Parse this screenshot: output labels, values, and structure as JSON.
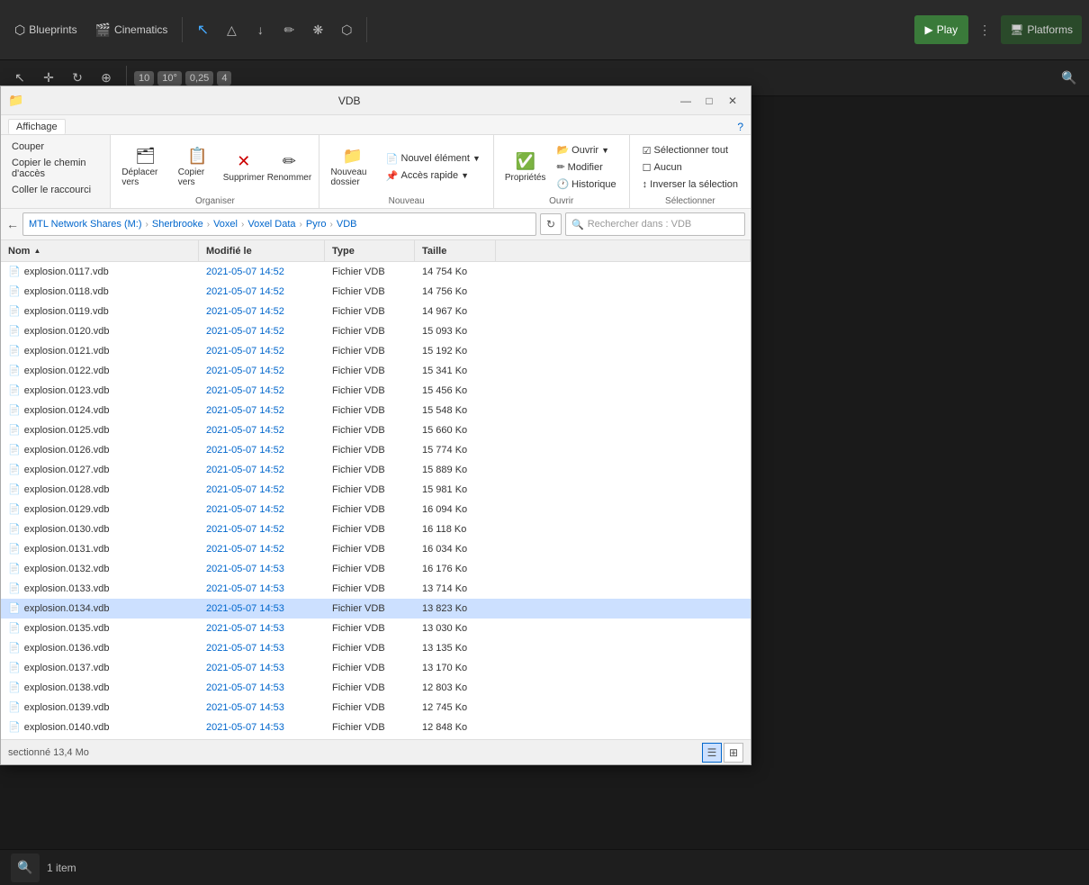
{
  "topbar": {
    "blueprints_label": "Blueprints",
    "cinematics_label": "Cinematics",
    "play_label": "Play",
    "platforms_label": "Platforms",
    "toolbar_nums": {
      "grid": "10",
      "angle": "10°",
      "scale": "0,25",
      "layers": "4"
    }
  },
  "window": {
    "title": "VDB",
    "ribbon": {
      "affichage_label": "Affichage",
      "context_menu": [
        "Couper",
        "Copier le chemin d'accès",
        "Coller le raccourci"
      ],
      "groups": {
        "organiser": {
          "label": "Organiser",
          "btn_deplacer": "Déplacer vers",
          "btn_copier": "Copier vers",
          "btn_supprimer": "Supprimer",
          "btn_renommer": "Renommer"
        },
        "nouveau": {
          "label": "Nouveau",
          "btn_nouveau_dossier": "Nouveau dossier",
          "btn_nouvel_element": "Nouvel élément",
          "btn_acces_rapide": "Accès rapide"
        },
        "ouvrir": {
          "label": "Ouvrir",
          "btn_proprietes": "Propriétés",
          "btn_ouvrir": "Ouvrir",
          "btn_modifier": "Modifier",
          "btn_historique": "Historique"
        },
        "selectionner": {
          "label": "Sélectionner",
          "btn_tout": "Sélectionner tout",
          "btn_aucun": "Aucun",
          "btn_inverser": "Inverser la sélection"
        }
      }
    },
    "breadcrumb": {
      "parts": [
        "MTL Network Shares (M:)",
        "Sherbrooke",
        "Voxel",
        "Voxel Data",
        "Pyro",
        "VDB"
      ]
    },
    "search_placeholder": "Rechercher dans : VDB",
    "columns": {
      "name": "Nom",
      "modified": "Modifié le",
      "type": "Type",
      "size": "Taille"
    },
    "files": [
      {
        "name": "explosion.0117.vdb",
        "modified": "2021-05-07 14:52",
        "type": "Fichier VDB",
        "size": "14 754 Ko"
      },
      {
        "name": "explosion.0118.vdb",
        "modified": "2021-05-07 14:52",
        "type": "Fichier VDB",
        "size": "14 756 Ko"
      },
      {
        "name": "explosion.0119.vdb",
        "modified": "2021-05-07 14:52",
        "type": "Fichier VDB",
        "size": "14 967 Ko"
      },
      {
        "name": "explosion.0120.vdb",
        "modified": "2021-05-07 14:52",
        "type": "Fichier VDB",
        "size": "15 093 Ko"
      },
      {
        "name": "explosion.0121.vdb",
        "modified": "2021-05-07 14:52",
        "type": "Fichier VDB",
        "size": "15 192 Ko"
      },
      {
        "name": "explosion.0122.vdb",
        "modified": "2021-05-07 14:52",
        "type": "Fichier VDB",
        "size": "15 341 Ko"
      },
      {
        "name": "explosion.0123.vdb",
        "modified": "2021-05-07 14:52",
        "type": "Fichier VDB",
        "size": "15 456 Ko"
      },
      {
        "name": "explosion.0124.vdb",
        "modified": "2021-05-07 14:52",
        "type": "Fichier VDB",
        "size": "15 548 Ko"
      },
      {
        "name": "explosion.0125.vdb",
        "modified": "2021-05-07 14:52",
        "type": "Fichier VDB",
        "size": "15 660 Ko"
      },
      {
        "name": "explosion.0126.vdb",
        "modified": "2021-05-07 14:52",
        "type": "Fichier VDB",
        "size": "15 774 Ko"
      },
      {
        "name": "explosion.0127.vdb",
        "modified": "2021-05-07 14:52",
        "type": "Fichier VDB",
        "size": "15 889 Ko"
      },
      {
        "name": "explosion.0128.vdb",
        "modified": "2021-05-07 14:52",
        "type": "Fichier VDB",
        "size": "15 981 Ko"
      },
      {
        "name": "explosion.0129.vdb",
        "modified": "2021-05-07 14:52",
        "type": "Fichier VDB",
        "size": "16 094 Ko"
      },
      {
        "name": "explosion.0130.vdb",
        "modified": "2021-05-07 14:52",
        "type": "Fichier VDB",
        "size": "16 118 Ko"
      },
      {
        "name": "explosion.0131.vdb",
        "modified": "2021-05-07 14:52",
        "type": "Fichier VDB",
        "size": "16 034 Ko"
      },
      {
        "name": "explosion.0132.vdb",
        "modified": "2021-05-07 14:53",
        "type": "Fichier VDB",
        "size": "16 176 Ko"
      },
      {
        "name": "explosion.0133.vdb",
        "modified": "2021-05-07 14:53",
        "type": "Fichier VDB",
        "size": "13 714 Ko"
      },
      {
        "name": "explosion.0134.vdb",
        "modified": "2021-05-07 14:53",
        "type": "Fichier VDB",
        "size": "13 823 Ko",
        "selected": true
      },
      {
        "name": "explosion.0135.vdb",
        "modified": "2021-05-07 14:53",
        "type": "Fichier VDB",
        "size": "13 030 Ko"
      },
      {
        "name": "explosion.0136.vdb",
        "modified": "2021-05-07 14:53",
        "type": "Fichier VDB",
        "size": "13 135 Ko"
      },
      {
        "name": "explosion.0137.vdb",
        "modified": "2021-05-07 14:53",
        "type": "Fichier VDB",
        "size": "13 170 Ko"
      },
      {
        "name": "explosion.0138.vdb",
        "modified": "2021-05-07 14:53",
        "type": "Fichier VDB",
        "size": "12 803 Ko"
      },
      {
        "name": "explosion.0139.vdb",
        "modified": "2021-05-07 14:53",
        "type": "Fichier VDB",
        "size": "12 745 Ko"
      },
      {
        "name": "explosion.0140.vdb",
        "modified": "2021-05-07 14:53",
        "type": "Fichier VDB",
        "size": "12 848 Ko"
      }
    ],
    "status": "sectionné  13,4 Mo",
    "status_items": "1 item"
  },
  "bottombar": {
    "items_label": "1 item",
    "search_icon": "🔍"
  },
  "icons": {
    "minimize": "—",
    "maximize": "□",
    "close": "✕",
    "file": "📄",
    "folder": "📁",
    "refresh": "↻",
    "search": "🔍",
    "arrow_back": "←",
    "play": "▶",
    "chevron": "›",
    "sort_asc": "▲"
  }
}
